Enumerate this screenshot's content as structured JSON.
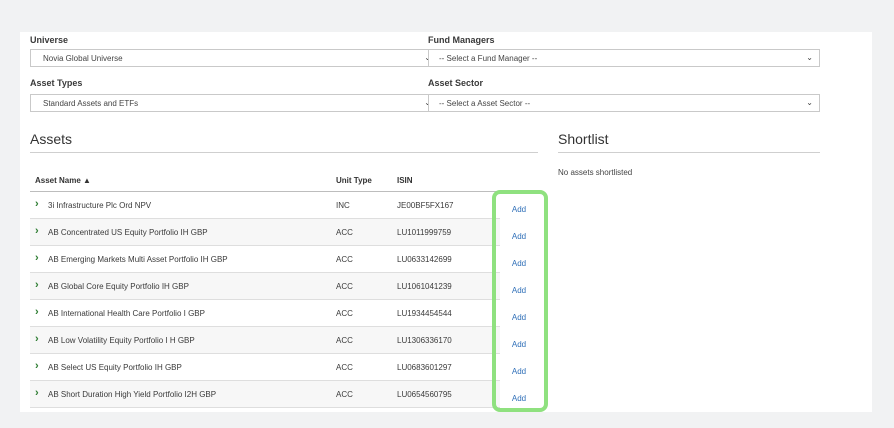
{
  "filters": {
    "universe": {
      "label": "Universe",
      "value": "Novia Global Universe"
    },
    "fund_managers": {
      "label": "Fund Managers",
      "value": "-- Select a Fund Manager --"
    },
    "asset_types": {
      "label": "Asset Types",
      "value": "Standard Assets and ETFs"
    },
    "asset_sector": {
      "label": "Asset Sector",
      "value": "-- Select a Asset Sector --"
    }
  },
  "assets": {
    "title": "Assets",
    "columns": {
      "name": "Asset Name ▲",
      "unit_type": "Unit Type",
      "isin": "ISIN"
    },
    "add_label": "Add",
    "rows": [
      {
        "name": "3i Infrastructure Plc Ord NPV",
        "unit_type": "INC",
        "isin": "JE00BF5FX167"
      },
      {
        "name": "AB Concentrated US Equity Portfolio IH GBP",
        "unit_type": "ACC",
        "isin": "LU1011999759"
      },
      {
        "name": "AB Emerging Markets Multi Asset Portfolio IH GBP",
        "unit_type": "ACC",
        "isin": "LU0633142699"
      },
      {
        "name": "AB Global Core Equity Portfolio IH GBP",
        "unit_type": "ACC",
        "isin": "LU1061041239"
      },
      {
        "name": "AB International Health Care Portfolio I GBP",
        "unit_type": "ACC",
        "isin": "LU1934454544"
      },
      {
        "name": "AB Low Volatility Equity Portfolio I H GBP",
        "unit_type": "ACC",
        "isin": "LU1306336170"
      },
      {
        "name": "AB Select US Equity Portfolio IH GBP",
        "unit_type": "ACC",
        "isin": "LU0683601297"
      },
      {
        "name": "AB Short Duration High Yield Portfolio I2H GBP",
        "unit_type": "ACC",
        "isin": "LU0654560795"
      }
    ]
  },
  "shortlist": {
    "title": "Shortlist",
    "empty_text": "No assets shortlisted"
  },
  "icons": {
    "dropdown": "chevron-down-icon",
    "expand": "chevron-right-icon"
  },
  "colors": {
    "highlight": "#8fe17f",
    "link": "#2f6fb8",
    "expand_chevron": "#2e7d32"
  }
}
